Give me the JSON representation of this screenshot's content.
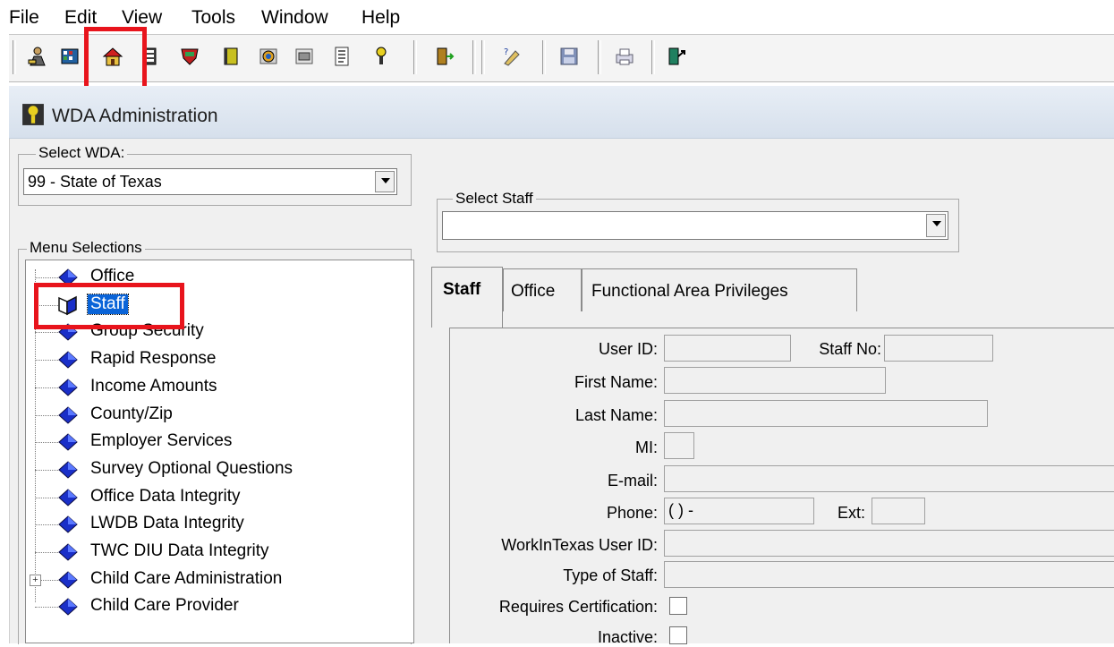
{
  "menu": {
    "items": [
      "File",
      "Edit",
      "View",
      "Tools",
      "Window",
      "Help"
    ]
  },
  "window": {
    "title": "WDA Administration"
  },
  "select_wda": {
    "label": "Select WDA:",
    "value": "99 - State of Texas"
  },
  "menu_selections": {
    "label": "Menu Selections",
    "items": [
      {
        "label": "Office"
      },
      {
        "label": "Staff"
      },
      {
        "label": "Group Security"
      },
      {
        "label": "Rapid Response"
      },
      {
        "label": "Income Amounts"
      },
      {
        "label": "County/Zip"
      },
      {
        "label": "Employer Services"
      },
      {
        "label": "Survey Optional Questions"
      },
      {
        "label": "Office Data Integrity"
      },
      {
        "label": "LWDB Data Integrity"
      },
      {
        "label": "TWC DIU Data Integrity"
      },
      {
        "label": "Child Care Administration"
      },
      {
        "label": "Child Care Provider"
      }
    ]
  },
  "select_staff": {
    "label": "Select Staff",
    "value": ""
  },
  "tabs": [
    {
      "label": "Staff"
    },
    {
      "label": "Office"
    },
    {
      "label": "Functional Area Privileges"
    }
  ],
  "form": {
    "user_id": {
      "label": "User ID:",
      "value": ""
    },
    "staff_no": {
      "label": "Staff No:",
      "value": ""
    },
    "first_name": {
      "label": "First Name:",
      "value": ""
    },
    "last_name": {
      "label": "Last Name:",
      "value": ""
    },
    "mi": {
      "label": "MI:",
      "value": ""
    },
    "email": {
      "label": "E-mail:",
      "value": ""
    },
    "phone": {
      "label": "Phone:",
      "value": "(   )     -"
    },
    "ext": {
      "label": "Ext:",
      "value": ""
    },
    "workintexas_id": {
      "label": "WorkInTexas User ID:",
      "value": ""
    },
    "type_of_staff": {
      "label": "Type of Staff:",
      "value": ""
    },
    "requires_certification": {
      "label": "Requires Certification:"
    },
    "inactive": {
      "label": "Inactive:"
    }
  },
  "colors": {
    "highlight_box": "#e8141c",
    "selection": "#0a64d8",
    "tree_icon": "#1a2fc8"
  }
}
